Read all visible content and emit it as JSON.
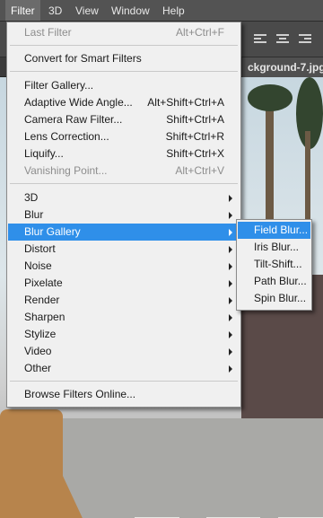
{
  "menubar": {
    "items": [
      {
        "label": "Filter",
        "active": true
      },
      {
        "label": "3D",
        "active": false
      },
      {
        "label": "View",
        "active": false
      },
      {
        "label": "Window",
        "active": false
      },
      {
        "label": "Help",
        "active": false
      }
    ]
  },
  "document_tab": {
    "title": "ckground-7.jpg @"
  },
  "filter_menu": {
    "items": [
      {
        "label": "Last Filter",
        "shortcut": "Alt+Ctrl+F",
        "disabled": true,
        "submenu": false
      },
      {
        "label": "Convert for Smart Filters",
        "shortcut": "",
        "disabled": false,
        "submenu": false
      },
      {
        "label": "Filter Gallery...",
        "shortcut": "",
        "disabled": false,
        "submenu": false
      },
      {
        "label": "Adaptive Wide Angle...",
        "shortcut": "Alt+Shift+Ctrl+A",
        "disabled": false,
        "submenu": false
      },
      {
        "label": "Camera Raw Filter...",
        "shortcut": "Shift+Ctrl+A",
        "disabled": false,
        "submenu": false
      },
      {
        "label": "Lens Correction...",
        "shortcut": "Shift+Ctrl+R",
        "disabled": false,
        "submenu": false
      },
      {
        "label": "Liquify...",
        "shortcut": "Shift+Ctrl+X",
        "disabled": false,
        "submenu": false
      },
      {
        "label": "Vanishing Point...",
        "shortcut": "Alt+Ctrl+V",
        "disabled": true,
        "submenu": false
      },
      {
        "label": "3D",
        "shortcut": "",
        "disabled": false,
        "submenu": true
      },
      {
        "label": "Blur",
        "shortcut": "",
        "disabled": false,
        "submenu": true
      },
      {
        "label": "Blur Gallery",
        "shortcut": "",
        "disabled": false,
        "submenu": true,
        "highlighted": true
      },
      {
        "label": "Distort",
        "shortcut": "",
        "disabled": false,
        "submenu": true
      },
      {
        "label": "Noise",
        "shortcut": "",
        "disabled": false,
        "submenu": true
      },
      {
        "label": "Pixelate",
        "shortcut": "",
        "disabled": false,
        "submenu": true
      },
      {
        "label": "Render",
        "shortcut": "",
        "disabled": false,
        "submenu": true
      },
      {
        "label": "Sharpen",
        "shortcut": "",
        "disabled": false,
        "submenu": true
      },
      {
        "label": "Stylize",
        "shortcut": "",
        "disabled": false,
        "submenu": true
      },
      {
        "label": "Video",
        "shortcut": "",
        "disabled": false,
        "submenu": true
      },
      {
        "label": "Other",
        "shortcut": "",
        "disabled": false,
        "submenu": true
      },
      {
        "label": "Browse Filters Online...",
        "shortcut": "",
        "disabled": false,
        "submenu": false
      }
    ]
  },
  "blur_gallery_submenu": {
    "items": [
      {
        "label": "Field Blur...",
        "highlighted": true
      },
      {
        "label": "Iris Blur...",
        "highlighted": false
      },
      {
        "label": "Tilt-Shift...",
        "highlighted": false
      },
      {
        "label": "Path Blur...",
        "highlighted": false
      },
      {
        "label": "Spin Blur...",
        "highlighted": false
      }
    ]
  },
  "colors": {
    "highlight": "#2f8fe9",
    "menu_background": "#f0f0f0",
    "menubar_background": "#535353"
  }
}
